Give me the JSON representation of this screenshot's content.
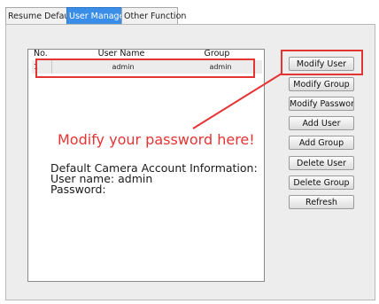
{
  "tabs": [
    "Resume Default",
    "User Manager",
    "Other Function"
  ],
  "active_tab": "User Manager",
  "table": {
    "headers": [
      "No.",
      "User Name",
      "Group"
    ],
    "rows": [
      {
        "no": "1",
        "user_name": "admin",
        "group": "admin"
      }
    ]
  },
  "buttons": {
    "modify_user": "Modify User",
    "modify_group": "Modify Group",
    "modify_password": "Modify Password",
    "add_user": "Add User",
    "add_group": "Add Group",
    "delete_user": "Delete User",
    "delete_group": "Delete Group",
    "refresh": "Refresh"
  },
  "annotation": {
    "modify_text": "Modify your password here!",
    "info_line1": "Default Camera Account Information:",
    "info_line2": "User name: admin",
    "info_line3": "Password:"
  },
  "colors": {
    "highlight": "#e53434",
    "active_tab": "#3b8ee8"
  }
}
